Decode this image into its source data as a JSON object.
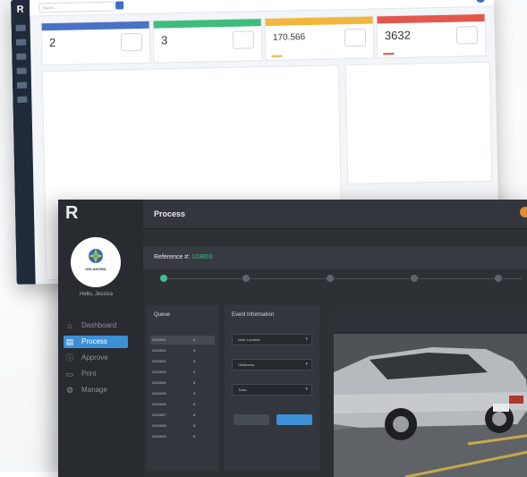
{
  "dashboard": {
    "logo": "R",
    "search_placeholder": "Search...",
    "cards": [
      {
        "value": "2",
        "color": "#4a72c4"
      },
      {
        "value": "3",
        "color": "#3ebc7c"
      },
      {
        "value": "170.566",
        "color": "#f0b73a"
      },
      {
        "value": "3632",
        "color": "#e2574c"
      }
    ]
  },
  "process": {
    "logo": "R",
    "title": "Process",
    "agency": "OKLAHOMA",
    "greeting": "Hello, Jessica",
    "reference_label": "Reference #:",
    "reference_value": "163803",
    "nav": [
      {
        "label": "Dashboard",
        "icon": "home-icon",
        "active": false
      },
      {
        "label": "Process",
        "icon": "process-icon",
        "active": true
      },
      {
        "label": "Approve",
        "icon": "approve-icon",
        "active": false
      },
      {
        "label": "Print",
        "icon": "print-icon",
        "active": false
      },
      {
        "label": "Manage",
        "icon": "gear-icon",
        "active": false
      }
    ],
    "queue": {
      "title": "Queue",
      "rows": [
        {
          "id": "2014001",
          "count": "9"
        },
        {
          "id": "2024001",
          "count": "9"
        },
        {
          "id": "2024002",
          "count": "9"
        },
        {
          "id": "2024003",
          "count": "9"
        },
        {
          "id": "2024004",
          "count": "8"
        },
        {
          "id": "2024005",
          "count": "9"
        },
        {
          "id": "2024006",
          "count": "8"
        },
        {
          "id": "2024007",
          "count": "8"
        },
        {
          "id": "2024008",
          "count": "8"
        },
        {
          "id": "2024009",
          "count": "8"
        }
      ]
    },
    "event": {
      "title": "Event Information",
      "fields": [
        {
          "value": "Near Location"
        },
        {
          "value": "Oklahoma"
        },
        {
          "value": "Tulsa"
        }
      ]
    }
  }
}
